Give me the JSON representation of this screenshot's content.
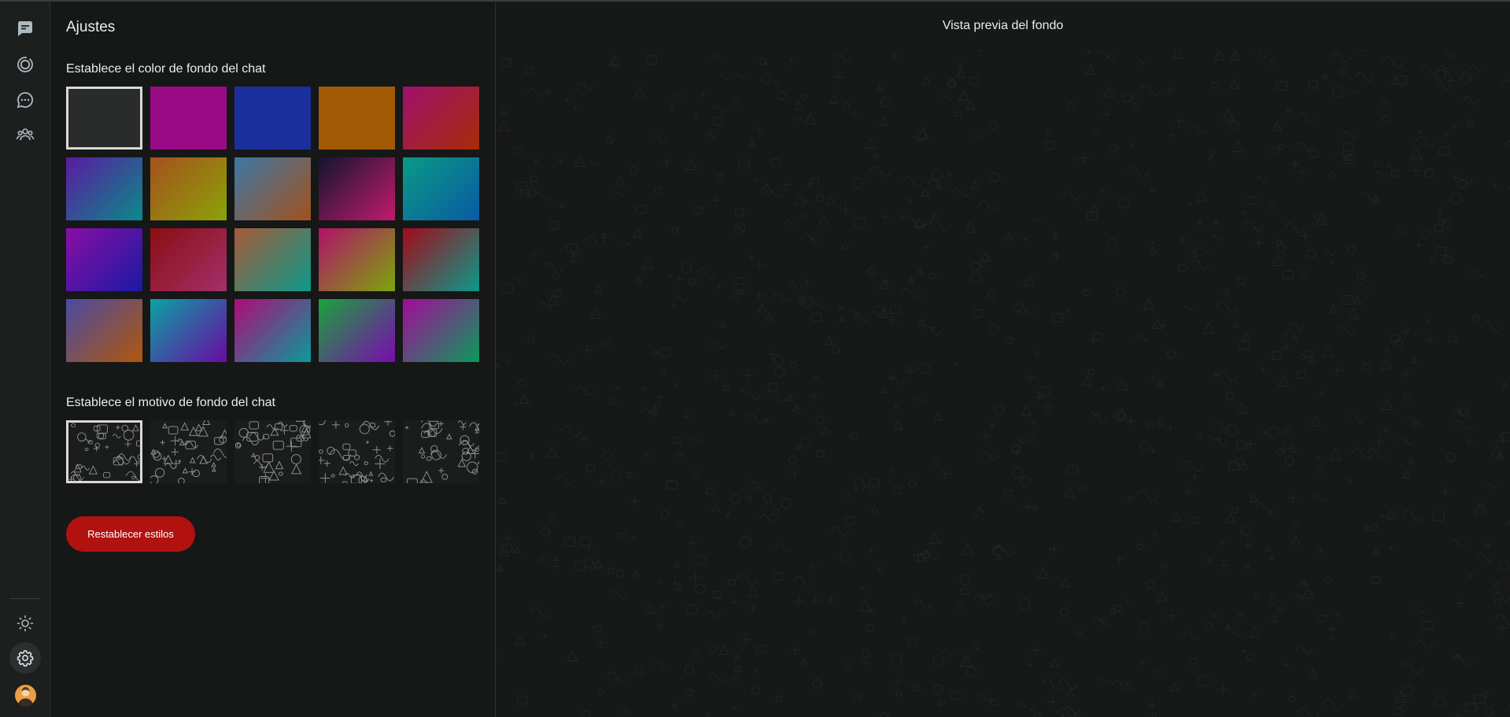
{
  "settings": {
    "title": "Ajustes",
    "color_section_label": "Establece el color de fondo del chat",
    "motif_section_label": "Establece el motivo de fondo del chat",
    "reset_label": "Restablecer estilos"
  },
  "preview": {
    "title": "Vista previa del fondo"
  },
  "nav": {
    "items": [
      {
        "icon": "chats-icon"
      },
      {
        "icon": "status-icon"
      },
      {
        "icon": "channels-icon"
      },
      {
        "icon": "communities-icon"
      },
      {
        "icon": "theme-icon"
      },
      {
        "icon": "settings-icon"
      },
      {
        "icon": "avatar"
      }
    ]
  },
  "swatches": [
    {
      "id": "default",
      "c1": "#2a2b2b",
      "c2": "#2a2b2b",
      "selected": true
    },
    {
      "id": "magenta",
      "c1": "#9b0a85",
      "c2": "#9b0a85"
    },
    {
      "id": "blue",
      "c1": "#1a2f9c",
      "c2": "#1a2f9c"
    },
    {
      "id": "orange",
      "c1": "#a35a06",
      "c2": "#a35a06"
    },
    {
      "id": "crimson",
      "c1": "#a1106e",
      "c2": "#a52c05"
    },
    {
      "id": "purple-teal",
      "c1": "#5b1aa0",
      "c2": "#0a8a8a"
    },
    {
      "id": "rust-olive",
      "c1": "#a6501e",
      "c2": "#8ba308"
    },
    {
      "id": "steel-rust",
      "c1": "#3d78a6",
      "c2": "#a3511c"
    },
    {
      "id": "navy-pink",
      "c1": "#141530",
      "c2": "#c21a6c"
    },
    {
      "id": "teal-blue",
      "c1": "#0a9a86",
      "c2": "#0a5aa3"
    },
    {
      "id": "violet-indigo",
      "c1": "#8a0ea5",
      "c2": "#1a1aa3"
    },
    {
      "id": "maroon-rose",
      "c1": "#8a0e12",
      "c2": "#a3306a"
    },
    {
      "id": "tan-teal",
      "c1": "#a55a3a",
      "c2": "#0a9a8a"
    },
    {
      "id": "magenta-lime",
      "c1": "#b0106a",
      "c2": "#7aa70a"
    },
    {
      "id": "red-teal",
      "c1": "#a30a1a",
      "c2": "#0a9a8a"
    },
    {
      "id": "slate-orange",
      "c1": "#4a4aa3",
      "c2": "#b0580a"
    },
    {
      "id": "cyan-purple",
      "c1": "#0aa3a3",
      "c2": "#6a0aa3"
    },
    {
      "id": "pink-teal",
      "c1": "#b00a7a",
      "c2": "#0a9a9a"
    },
    {
      "id": "green-purple",
      "c1": "#1aa33a",
      "c2": "#7a0ab0"
    },
    {
      "id": "fuchsia-green",
      "c1": "#a30a9a",
      "c2": "#0a9a5a"
    }
  ],
  "motifs": [
    {
      "id": "doodle-1",
      "selected": true
    },
    {
      "id": "doodle-2"
    },
    {
      "id": "doodle-3"
    },
    {
      "id": "doodle-4"
    },
    {
      "id": "doodle-5"
    }
  ]
}
